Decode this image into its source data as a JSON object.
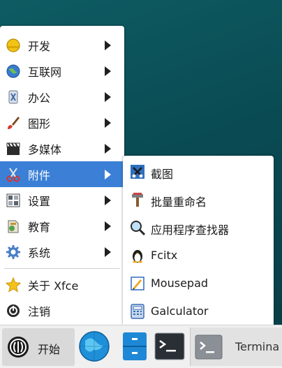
{
  "menu": {
    "items": [
      {
        "label": "开发",
        "icon": "hardhat-icon",
        "submenu": true
      },
      {
        "label": "互联网",
        "icon": "globe-icon",
        "submenu": true
      },
      {
        "label": "办公",
        "icon": "office-icon",
        "submenu": true
      },
      {
        "label": "图形",
        "icon": "brush-icon",
        "submenu": true
      },
      {
        "label": "多媒体",
        "icon": "clapperboard-icon",
        "submenu": true
      },
      {
        "label": "附件",
        "icon": "scissors-icon",
        "submenu": true,
        "active": true
      },
      {
        "label": "设置",
        "icon": "settings-panel-icon",
        "submenu": true
      },
      {
        "label": "教育",
        "icon": "education-icon",
        "submenu": true
      },
      {
        "label": "系统",
        "icon": "gear-icon",
        "submenu": true
      },
      {
        "label": "关于 Xfce",
        "icon": "star-icon",
        "submenu": false
      },
      {
        "label": "注销",
        "icon": "logout-icon",
        "submenu": false
      }
    ]
  },
  "submenu": {
    "items": [
      {
        "label": "截图",
        "icon": "screenshot-icon"
      },
      {
        "label": "批量重命名",
        "icon": "rename-icon"
      },
      {
        "label": "应用程序查找器",
        "icon": "magnifier-icon"
      },
      {
        "label": "Fcitx",
        "icon": "penguin-icon"
      },
      {
        "label": "Mousepad",
        "icon": "text-editor-icon"
      },
      {
        "label": "Galculator",
        "icon": "calculator-icon"
      }
    ]
  },
  "panel": {
    "start_label": "开始",
    "task_label": "Termina"
  },
  "colors": {
    "highlight": "#3b80d6",
    "desktop": "#0a4b53"
  }
}
